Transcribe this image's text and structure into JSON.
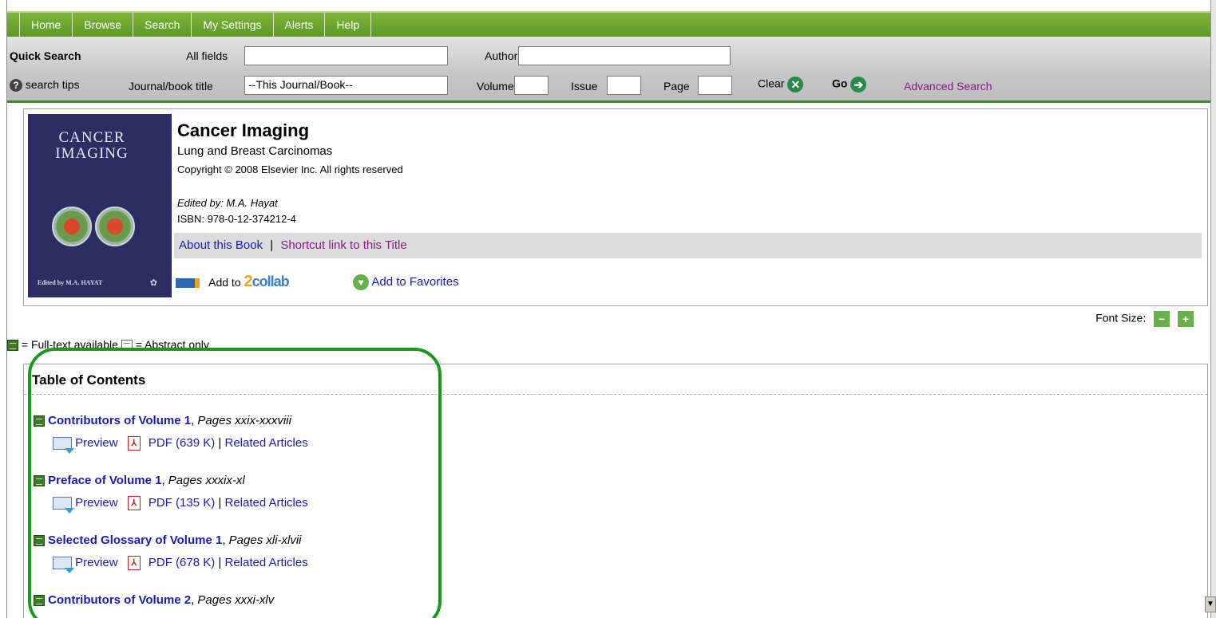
{
  "nav": {
    "tabs": [
      "Home",
      "Browse",
      "Search",
      "My Settings",
      "Alerts",
      "Help"
    ]
  },
  "quick_search": {
    "label": "Quick Search",
    "all_fields_label": "All fields",
    "all_fields_value": "",
    "author_label": "Author",
    "author_value": "",
    "search_tips": "search tips",
    "journal_label": "Journal/book title",
    "journal_value": "--This Journal/Book--",
    "volume_label": "Volume",
    "issue_label": "Issue",
    "page_label": "Page",
    "clear_label": "Clear",
    "go_label": "Go",
    "advanced_label": "Advanced Search"
  },
  "book": {
    "cover_title_line1": "CANCER",
    "cover_title_line2": "IMAGING",
    "cover_editor": "Edited by M.A. HAYAT",
    "title": "Cancer Imaging",
    "subtitle": "Lung and Breast Carcinomas",
    "copyright": "Copyright © 2008 Elsevier Inc. All rights reserved",
    "editor": "Edited by: M.A. Hayat",
    "isbn": "ISBN: 978-0-12-374212-4",
    "about_link": "About this Book",
    "separator": "|",
    "shortcut_link": "Shortcut link to this Title",
    "add_to_label": "Add to",
    "collab_logo_two": "2",
    "collab_logo_rest": "collab",
    "favorites_label": "Add to Favorites"
  },
  "font_size_label": "Font Size:",
  "legend": {
    "full_text": "= Full-text available",
    "abstract_only": "= Abstract only"
  },
  "toc": {
    "title": "Table of Contents",
    "entries": [
      {
        "title": "Contributors of Volume 1",
        "pages": "Pages xxix-xxxviii",
        "preview": "Preview",
        "pdf": "PDF (639 K)",
        "sep": "|",
        "related": "Related Articles"
      },
      {
        "title": "Preface of Volume 1",
        "pages": "Pages xxxix-xl",
        "preview": "Preview",
        "pdf": "PDF (135 K)",
        "sep": "|",
        "related": "Related Articles"
      },
      {
        "title": "Selected Glossary of Volume 1",
        "pages": "Pages xli-xlvii",
        "preview": "Preview",
        "pdf": "PDF (678 K)",
        "sep": "|",
        "related": "Related Articles"
      },
      {
        "title": "Contributors of Volume 2",
        "pages": "Pages xxxi-xlv"
      }
    ]
  },
  "colors": {
    "nav_green": "#5c9a25",
    "highlight": "#1a9a1a",
    "link": "#1a1ab8",
    "visited_link": "#8a1a8a"
  }
}
